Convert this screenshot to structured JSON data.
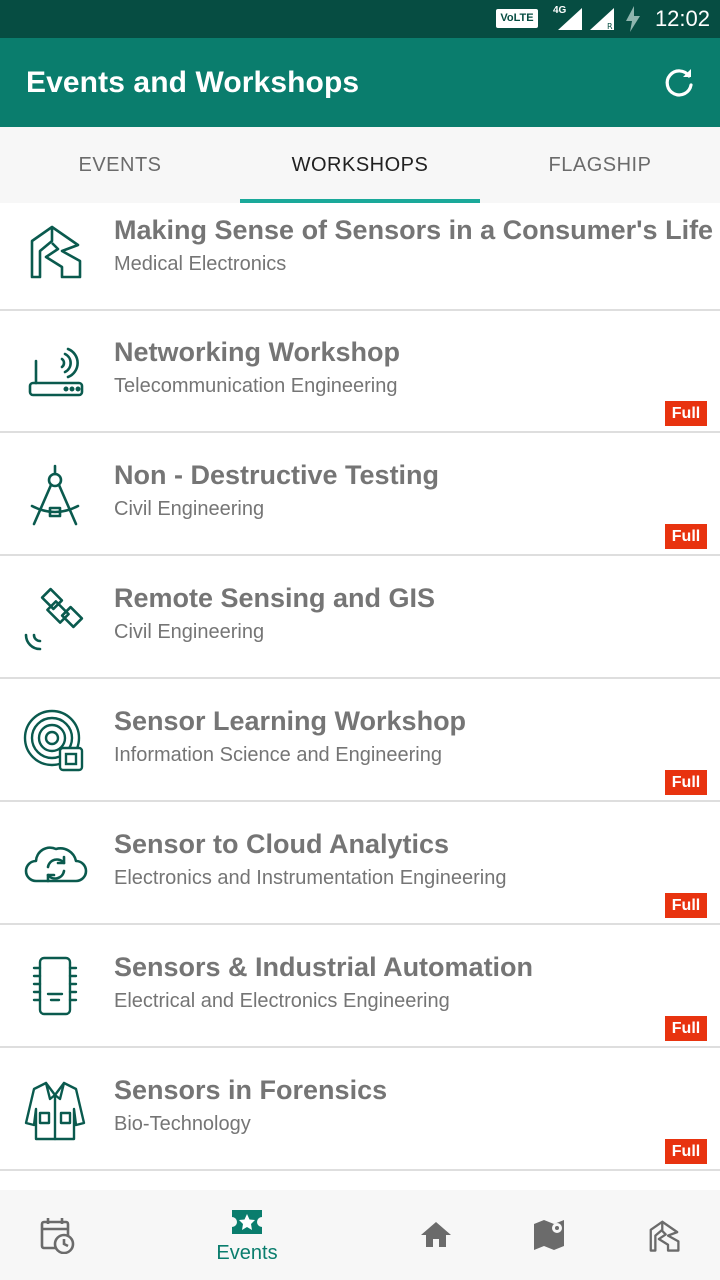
{
  "status_bar": {
    "volte": "VoLTE",
    "network": "4G",
    "time": "12:02"
  },
  "app_bar": {
    "title": "Events and Workshops",
    "refresh_icon": "refresh-icon"
  },
  "tabs": [
    {
      "label": "EVENTS",
      "active": false
    },
    {
      "label": "WORKSHOPS",
      "active": true
    },
    {
      "label": "FLAGSHIP",
      "active": false
    }
  ],
  "items": [
    {
      "title": "Making Sense of Sensors in a Consumer's Life",
      "subtitle": "Medical Electronics",
      "badge": "",
      "icon": "ps-logo-icon"
    },
    {
      "title": "Networking Workshop",
      "subtitle": "Telecommunication Engineering",
      "badge": "Full",
      "icon": "router-icon"
    },
    {
      "title": "Non - Destructive Testing",
      "subtitle": "Civil Engineering",
      "badge": "Full",
      "icon": "compass-icon"
    },
    {
      "title": "Remote Sensing and GIS",
      "subtitle": "Civil Engineering",
      "badge": "",
      "icon": "satellite-icon"
    },
    {
      "title": "Sensor Learning Workshop",
      "subtitle": "Information Science and Engineering",
      "badge": "Full",
      "icon": "sensor-rings-icon"
    },
    {
      "title": "Sensor to Cloud Analytics",
      "subtitle": "Electronics and Instrumentation Engineering",
      "badge": "Full",
      "icon": "cloud-sync-icon"
    },
    {
      "title": "Sensors & Industrial Automation",
      "subtitle": "Electrical and Electronics Engineering",
      "badge": "Full",
      "icon": "chip-icon"
    },
    {
      "title": "Sensors in Forensics",
      "subtitle": "Bio-Technology",
      "badge": "Full",
      "icon": "lab-coat-icon"
    }
  ],
  "bottom_nav": {
    "events_label": "Events",
    "active": "events"
  },
  "colors": {
    "status_bar": "#064d42",
    "app_bar": "#0a7d6d",
    "tab_indicator": "#1aa99a",
    "badge": "#e8330f",
    "icon": "#0a5a4e"
  }
}
